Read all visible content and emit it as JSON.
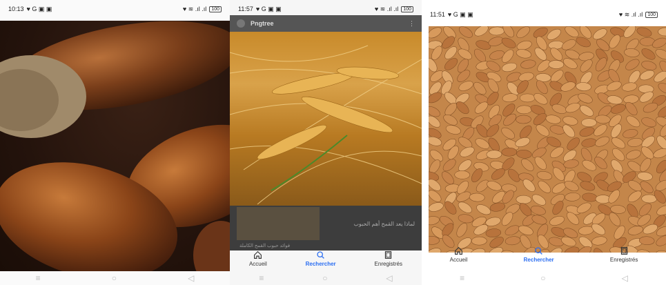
{
  "screens": [
    {
      "status": {
        "time": "10:13",
        "left_icons": "♥ G ▣ ▣",
        "right_icons": "♥ ≋ .ıl .ıl",
        "battery": "100"
      },
      "photo": "acorns-photo"
    },
    {
      "status": {
        "time": "11:57",
        "left_icons": "♥ G ▣ ▣",
        "right_icons": "♥ ≋ .ıl .ıl",
        "battery": "100"
      },
      "app_title": "Pngtree",
      "menu_icon": "⋮",
      "feed": {
        "text1": "لماذا يعد القمح أهم الحبوب",
        "text2": "فوائد حبوب القمح الكاملة"
      },
      "tabs": [
        {
          "label": "Accueil",
          "icon": "home-icon"
        },
        {
          "label": "Rechercher",
          "icon": "search-icon",
          "active": true
        },
        {
          "label": "Enregistrés",
          "icon": "bookmark-icon"
        }
      ]
    },
    {
      "status": {
        "time": "11:51",
        "left_icons": "♥ G ▣ ▣",
        "right_icons": "♥ ≋ .ıl .ıl",
        "battery": "100"
      },
      "photo": "wheat-grains-photo",
      "tabs": [
        {
          "label": "Accueil",
          "icon": "home-icon"
        },
        {
          "label": "Rechercher",
          "icon": "search-icon",
          "active": true
        },
        {
          "label": "Enregistrés",
          "icon": "bookmark-icon"
        }
      ]
    }
  ],
  "nav_buttons": {
    "menu": "≡",
    "home": "○",
    "back": "◁"
  },
  "colors": {
    "accent": "#2b6ef2"
  }
}
